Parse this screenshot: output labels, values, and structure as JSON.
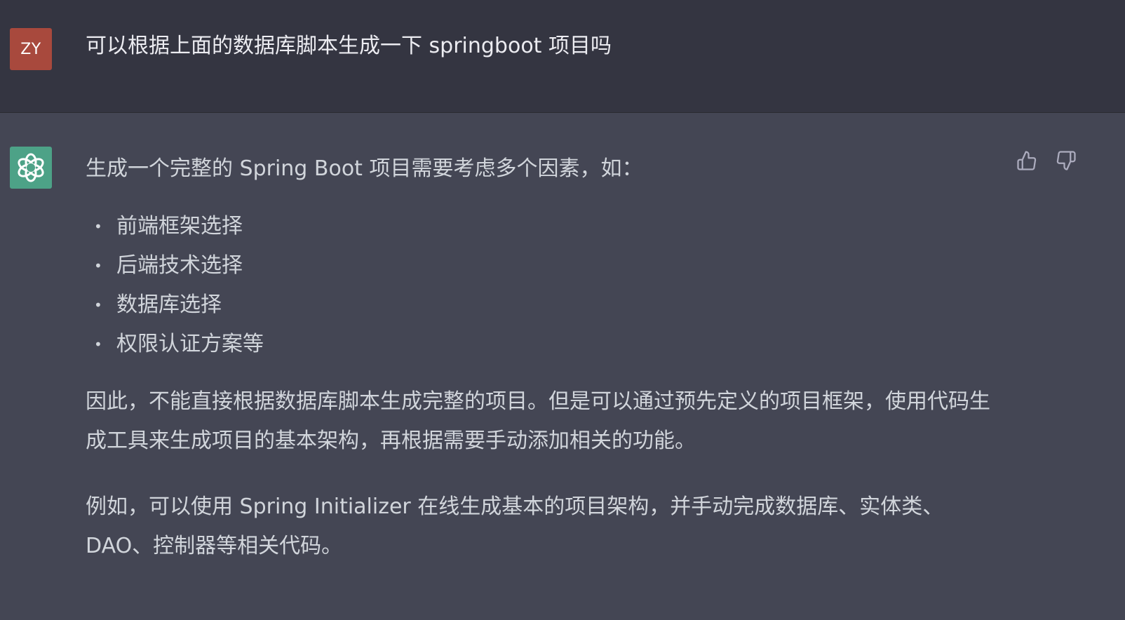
{
  "user_turn": {
    "avatar_initials": "ZY",
    "avatar_color": "#a8493d",
    "message": "可以根据上面的数据库脚本生成一下 springboot 项目吗"
  },
  "assistant_turn": {
    "avatar_icon": "openai-logo-icon",
    "avatar_color": "#4da287",
    "intro": "生成一个完整的 Spring Boot 项目需要考虑多个因素，如：",
    "list_items": [
      "前端框架选择",
      "后端技术选择",
      "数据库选择",
      "权限认证方案等"
    ],
    "paragraph_1": "因此，不能直接根据数据库脚本生成完整的项目。但是可以通过预先定义的项目框架，使用代码生成工具来生成项目的基本架构，再根据需要手动添加相关的功能。",
    "paragraph_2": "例如，可以使用 Spring Initializer 在线生成基本的项目架构，并手动完成数据库、实体类、DAO、控制器等相关代码。",
    "feedback": {
      "thumbs_up_icon": "thumbs-up-icon",
      "thumbs_down_icon": "thumbs-down-icon"
    }
  }
}
